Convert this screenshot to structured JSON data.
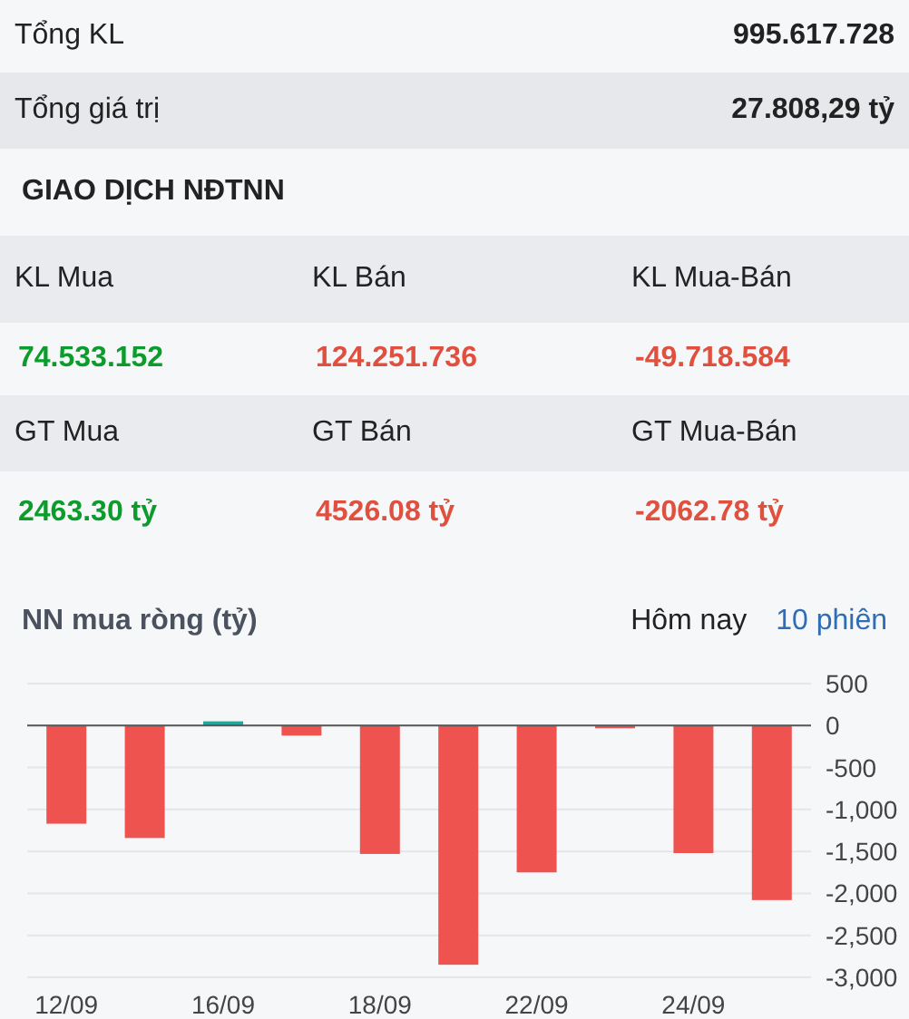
{
  "summary": [
    {
      "label": "Tổng KL",
      "value": "995.617.728"
    },
    {
      "label": "Tổng giá trị",
      "value": "27.808,29 tỷ"
    }
  ],
  "foreign_section": {
    "title": "GIAO DỊCH NĐTNN",
    "groups": [
      {
        "headers": [
          "KL Mua",
          "KL Bán",
          "KL Mua-Bán"
        ],
        "values": [
          {
            "text": "74.533.152",
            "color": "#0b9c2b"
          },
          {
            "text": "124.251.736",
            "color": "#e0503f"
          },
          {
            "text": "-49.718.584",
            "color": "#e0503f"
          }
        ]
      },
      {
        "headers": [
          "GT Mua",
          "GT Bán",
          "GT Mua-Bán"
        ],
        "values": [
          {
            "text": "2463.30 tỷ",
            "color": "#0b9c2b"
          },
          {
            "text": "4526.08 tỷ",
            "color": "#e0503f"
          },
          {
            "text": "-2062.78 tỷ",
            "color": "#e0503f"
          }
        ]
      }
    ]
  },
  "net_buy": {
    "title": "NN mua ròng (tỷ)",
    "periods": [
      {
        "label": "Hôm nay",
        "selected": false
      },
      {
        "label": "10 phiên",
        "selected": true
      }
    ],
    "chart_data": {
      "type": "bar",
      "grid": true,
      "categories": [
        "12/09",
        null,
        "16/09",
        null,
        "18/09",
        null,
        "22/09",
        null,
        "24/09",
        null
      ],
      "values": [
        -1170,
        -1340,
        50,
        -120,
        -1530,
        -2850,
        -1750,
        -20,
        -1520,
        -2080
      ],
      "ylim": [
        -3000,
        500
      ],
      "yticks": [
        {
          "value": 500,
          "label": "500"
        },
        {
          "value": 0,
          "label": "0"
        },
        {
          "value": -500,
          "label": "-500"
        },
        {
          "value": -1000,
          "label": "-1,000"
        },
        {
          "value": -1500,
          "label": "-1,500"
        },
        {
          "value": -2000,
          "label": "-2,000"
        },
        {
          "value": -2500,
          "label": "-2,500"
        },
        {
          "value": -3000,
          "label": "-3,000"
        }
      ]
    }
  }
}
